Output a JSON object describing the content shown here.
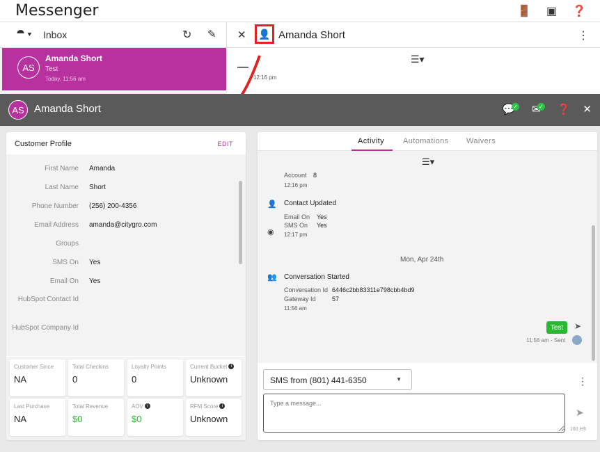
{
  "app": {
    "title": "Messenger"
  },
  "topbar_icons": [
    "door-icon",
    "box-icon",
    "help-icon"
  ],
  "inbox": {
    "label": "Inbox"
  },
  "conversation_header": {
    "name": "Amanda Short"
  },
  "conversation_list": [
    {
      "initials": "AS",
      "name": "Amanda Short",
      "preview": "Test",
      "time": "Today, 11:56 am"
    }
  ],
  "chat_preview": {
    "time": "12:16 pm"
  },
  "modal": {
    "initials": "AS",
    "name": "Amanda Short"
  },
  "profile": {
    "title": "Customer Profile",
    "edit_label": "EDIT",
    "fields": [
      {
        "label": "First Name",
        "value": "Amanda"
      },
      {
        "label": "Last Name",
        "value": "Short"
      },
      {
        "label": "Phone Number",
        "value": "(256) 200-4356"
      },
      {
        "label": "Email Address",
        "value": "amanda@citygro.com"
      },
      {
        "label": "Groups",
        "value": ""
      },
      {
        "label": "SMS On",
        "value": "Yes"
      },
      {
        "label": "Email On",
        "value": "Yes"
      },
      {
        "label": "HubSpot Contact Id",
        "value": ""
      },
      {
        "label": "HubSpot Company Id",
        "value": ""
      }
    ],
    "stats": [
      {
        "label": "Customer Since",
        "value": "NA",
        "info": false,
        "green": false
      },
      {
        "label": "Total Checkins",
        "value": "0",
        "info": false,
        "green": false
      },
      {
        "label": "Loyalty Points",
        "value": "0",
        "info": false,
        "green": false
      },
      {
        "label": "Current Bucket",
        "value": "Unknown",
        "info": true,
        "green": false
      },
      {
        "label": "Last Purchase",
        "value": "NA",
        "info": false,
        "green": false
      },
      {
        "label": "Total Revenue",
        "value": "$0",
        "info": false,
        "green": true
      },
      {
        "label": "AOV",
        "value": "$0",
        "info": true,
        "green": true
      },
      {
        "label": "RFM Score",
        "value": "Unknown",
        "info": true,
        "green": false
      }
    ]
  },
  "activity": {
    "tabs": [
      "Activity",
      "Automations",
      "Waivers"
    ],
    "active_tab": "Activity",
    "entries": {
      "account_label": "Account",
      "account_value": "8",
      "account_time": "12:16 pm",
      "contact_updated_title": "Contact Updated",
      "email_on_label": "Email On",
      "email_on_value": "Yes",
      "sms_on_label": "SMS On",
      "sms_on_value": "Yes",
      "contact_time": "12:17 pm",
      "date_divider": "Mon, Apr 24th",
      "conversation_title": "Conversation Started",
      "conversation_id_label": "Conversation Id",
      "conversation_id_value": "6446c2bb83311e798cbb4bd9",
      "gateway_label": "Gateway Id",
      "gateway_value": "57",
      "conversation_time": "11:56 am"
    },
    "message": {
      "text": "Test",
      "meta": "11:56 am - Sent"
    },
    "compose": {
      "from_label": "SMS from (801) 441-6350",
      "placeholder": "Type a message...",
      "char_count": "160 left"
    }
  },
  "colors": {
    "accent": "#b7329f",
    "header": "#5a5a5a",
    "success": "#2ab832",
    "highlight": "#e02424"
  }
}
